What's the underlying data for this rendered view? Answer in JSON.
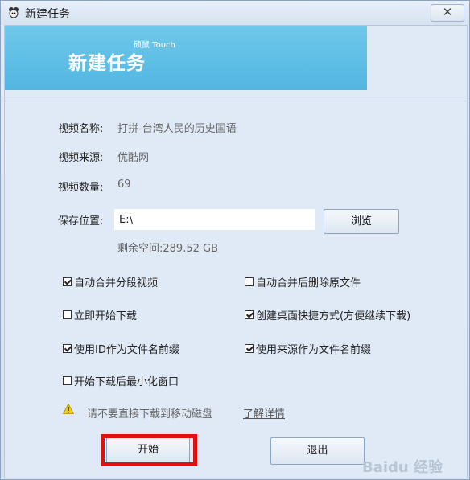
{
  "window": {
    "title": "新建任务",
    "close_glyph": "✕"
  },
  "banner": {
    "brand": "硕鼠 Touch",
    "title": "新建任务",
    "colors": {
      "banner": "#5bbde6",
      "text": "#ffffff"
    }
  },
  "info": {
    "name_label": "视频名称:",
    "name_value": "打拼-台湾人民的历史国语",
    "source_label": "视频来源:",
    "source_value": "优酷网",
    "count_label": "视频数量:",
    "count_value": "69"
  },
  "save": {
    "label": "保存位置:",
    "path": "E:\\",
    "browse_label": "浏览",
    "free_space": "剩余空间:289.52 GB"
  },
  "options": {
    "merge_segments": {
      "label": "自动合并分段视频",
      "checked": true
    },
    "delete_after_merge": {
      "label": "自动合并后删除原文件",
      "checked": false
    },
    "download_now": {
      "label": "立即开始下载",
      "checked": false
    },
    "desktop_shortcut": {
      "label": "创建桌面快捷方式(方便继续下载)",
      "checked": true
    },
    "id_prefix": {
      "label": "使用ID作为文件名前缀",
      "checked": true
    },
    "source_prefix": {
      "label": "使用来源作为文件名前缀",
      "checked": true
    },
    "minimize_on_start": {
      "label": "开始下载后最小化窗口",
      "checked": false
    }
  },
  "warning": {
    "icon": "warning-icon",
    "text": "请不要直接下载到移动磁盘",
    "link": "了解详情"
  },
  "actions": {
    "start_label": "开始",
    "exit_label": "退出",
    "highlight_color": "#e01010"
  },
  "watermark": "Baidu 经验"
}
